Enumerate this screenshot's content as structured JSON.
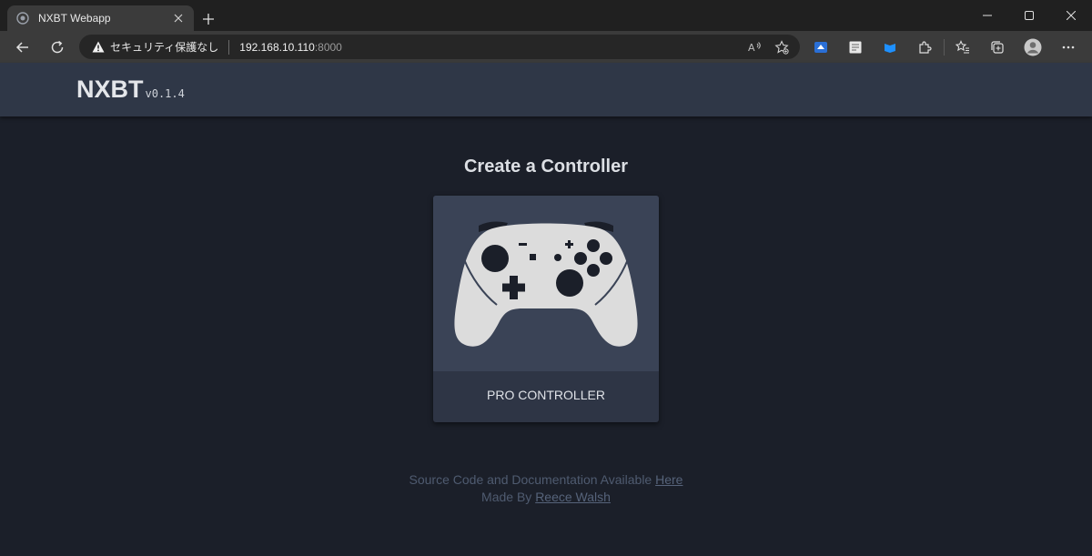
{
  "browser": {
    "tab": {
      "title": "NXBT Webapp"
    },
    "address": {
      "security_label": "セキュリティ保護なし",
      "url_host": "192.168.10.110",
      "url_port": ":8000"
    }
  },
  "app": {
    "name": "NXBT",
    "version": "v0.1.4"
  },
  "main": {
    "title": "Create a Controller",
    "controllers": [
      {
        "label": "PRO CONTROLLER"
      }
    ]
  },
  "footer": {
    "line1_text": "Source Code and Documentation Available ",
    "line1_link": "Here",
    "line2_text": "Made By ",
    "line2_link": "Reece Walsh"
  },
  "colors": {
    "page_bg": "#1b1f29",
    "header_bg": "#2f3747",
    "card_bg": "#2e3545",
    "card_image_bg": "#3a4356",
    "controller_body": "#dcdcdc",
    "controller_buttons": "#1b1f29"
  }
}
